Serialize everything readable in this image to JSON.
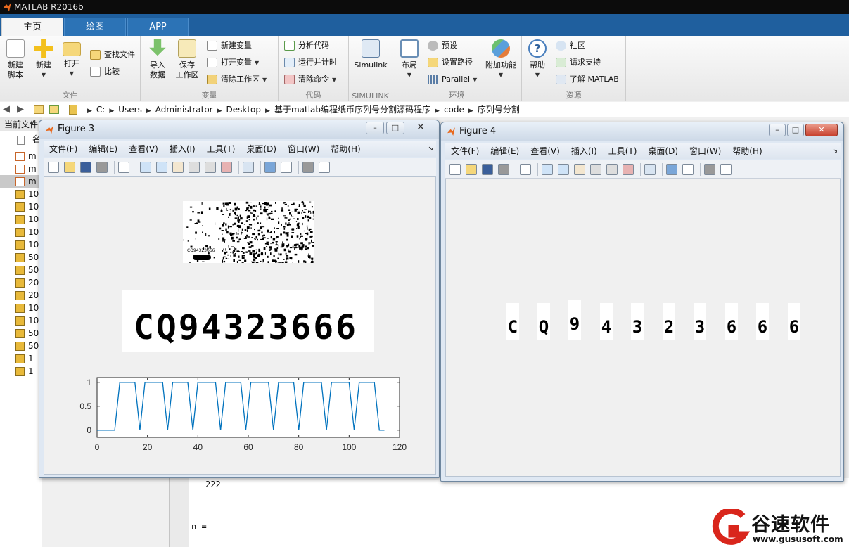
{
  "app": {
    "title": "MATLAB R2016b"
  },
  "tabs": [
    {
      "label": "主页",
      "active": true
    },
    {
      "label": "绘图",
      "active": false
    },
    {
      "label": "APP",
      "active": false
    }
  ],
  "ribbon": {
    "file": {
      "section_label": "文件",
      "new_script": "新建\n脚本",
      "new": "新建",
      "open": "打开",
      "find_files": "查找文件",
      "compare": "比较"
    },
    "variable": {
      "section_label": "变量",
      "import_data": "导入\n数据",
      "save_workspace": "保存\n工作区",
      "new_variable": "新建变量",
      "open_variable": "打开变量",
      "clear_workspace": "清除工作区"
    },
    "code": {
      "section_label": "代码",
      "analyze_code": "分析代码",
      "run_and_time": "运行并计时",
      "clear_commands": "清除命令"
    },
    "simulink": {
      "section_label": "SIMULINK",
      "simulink": "Simulink"
    },
    "environment": {
      "section_label": "环境",
      "layout": "布局",
      "preferences": "预设",
      "set_path": "设置路径",
      "parallel": "Parallel",
      "addons": "附加功能"
    },
    "resources": {
      "section_label": "资源",
      "help": "帮助",
      "community": "社区",
      "request_support": "请求支持",
      "learn_matlab": "了解 MATLAB"
    }
  },
  "breadcrumbs": [
    "C:",
    "Users",
    "Administrator",
    "Desktop",
    "基于matlab编程纸币序列号分割源码程序",
    "code",
    "序列号分割"
  ],
  "current_folder": {
    "header": "当前文件",
    "col_name_fragment": "名",
    "files": [
      {
        "name": "m",
        "icon": "m-file-icon"
      },
      {
        "name": "m",
        "icon": "m-file-icon"
      },
      {
        "name": "m",
        "icon": "m-file-icon",
        "selected": true
      },
      {
        "name": "10",
        "icon": "jpg-file-icon"
      },
      {
        "name": "10",
        "icon": "jpg-file-icon"
      },
      {
        "name": "10",
        "icon": "jpg-file-icon"
      },
      {
        "name": "10",
        "icon": "jpg-file-icon"
      },
      {
        "name": "10",
        "icon": "jpg-file-icon"
      },
      {
        "name": "50",
        "icon": "jpg-file-icon"
      },
      {
        "name": "50",
        "icon": "jpg-file-icon"
      },
      {
        "name": "20",
        "icon": "jpg-file-icon"
      },
      {
        "name": "20",
        "icon": "jpg-file-icon"
      },
      {
        "name": "10",
        "icon": "jpg-file-icon"
      },
      {
        "name": "10",
        "icon": "jpg-file-icon"
      },
      {
        "name": "50",
        "icon": "jpg-file-icon"
      },
      {
        "name": "50",
        "icon": "jpg-file-icon"
      },
      {
        "name": "1",
        "icon": "jpg-file-icon"
      },
      {
        "name": "1",
        "icon": "jpg-file-icon"
      }
    ]
  },
  "command_window": {
    "output_value": "222",
    "prompt_line": "n ="
  },
  "figure_menu": [
    "文件(F)",
    "编辑(E)",
    "查看(V)",
    "插入(I)",
    "工具(T)",
    "桌面(D)",
    "窗口(W)",
    "帮助(H)"
  ],
  "figure3": {
    "title": "Figure 3",
    "serial_text": "CQ94323666",
    "chart_data": {
      "type": "line",
      "x": [
        0,
        7,
        9,
        15,
        17,
        19,
        26,
        28,
        30,
        36,
        38,
        40,
        47,
        49,
        51,
        57,
        59,
        61,
        68,
        70,
        72,
        78,
        80,
        82,
        89,
        91,
        93,
        100,
        102,
        104,
        110,
        112,
        114
      ],
      "y": [
        0,
        0,
        1,
        1,
        0,
        1,
        1,
        0,
        1,
        1,
        0,
        1,
        1,
        0,
        1,
        1,
        0,
        1,
        1,
        0,
        1,
        1,
        0,
        1,
        1,
        0,
        1,
        1,
        0,
        1,
        1,
        0,
        0
      ],
      "xlim": [
        0,
        120
      ],
      "ylim": [
        -0.15,
        1.1
      ],
      "xticks": [
        "0",
        "20",
        "40",
        "60",
        "80",
        "100",
        "120"
      ],
      "yticks": [
        "0",
        "0.5",
        "1"
      ],
      "line_color": "#0072BD"
    }
  },
  "figure4": {
    "title": "Figure 4",
    "chars": [
      "C",
      "Q",
      "9",
      "4",
      "3",
      "2",
      "3",
      "6",
      "6",
      "6"
    ]
  },
  "watermark": {
    "brand": "谷速软件",
    "url": "www.gususoft.com"
  },
  "colors": {
    "tab_bar": "#1f5f9e",
    "plot_line": "#0072BD",
    "watermark_red": "#d9261c"
  }
}
